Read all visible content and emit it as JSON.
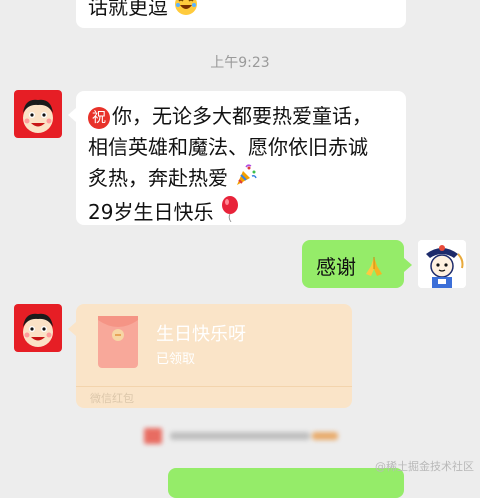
{
  "colors": {
    "background": "#ededed",
    "bubble_in": "#ffffff",
    "bubble_out": "#95ec69",
    "red_packet": "#fae4c8"
  },
  "messages": {
    "top_partial": {
      "text": "话就更逗",
      "emoji_icon": "laughing-face-icon"
    },
    "timestamp": "上午9:23",
    "wish": {
      "badge": "祝",
      "line1": "你，无论多大都要热爱童话，",
      "line2": "相信英雄和魔法、愿你依旧赤诚",
      "line3": "炙热，奔赴热爱",
      "line4": "29岁生日快乐",
      "party_icon": "party-popper-icon",
      "balloon_icon": "balloon-icon"
    },
    "thanks": {
      "text": "感谢",
      "emoji_icon": "folded-hands-icon"
    },
    "red_packet": {
      "title": "生日快乐呀",
      "status": "已领取",
      "footer": "微信红包"
    }
  },
  "watermark": "@稀土掘金技术社区"
}
